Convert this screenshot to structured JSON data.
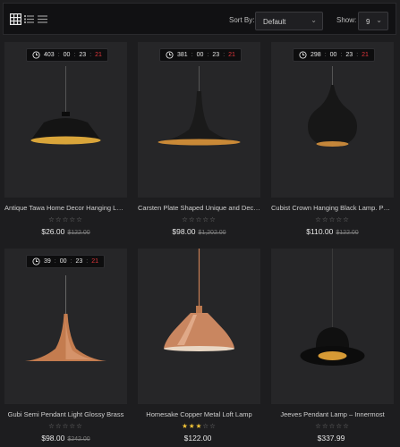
{
  "toolbar": {
    "view_modes": [
      "grid-view",
      "list-view",
      "compact-list-view"
    ],
    "sort_label": "Sort By:",
    "sort_value": "Default",
    "show_label": "Show:",
    "show_value": "9"
  },
  "products": [
    {
      "title": "Antique Tawa Home Decor Hanging Lamp",
      "price": "$26.00",
      "old_price": "$122.00",
      "rating": 0,
      "timer": {
        "days": "403",
        "hours": "00",
        "minutes": "23",
        "seconds": "21"
      }
    },
    {
      "title": "Carsten Plate Shaped Unique and Decorative Lamp",
      "price": "$98.00",
      "old_price": "$1,202.00",
      "rating": 0,
      "timer": {
        "days": "381",
        "hours": "00",
        "minutes": "23",
        "seconds": "21"
      }
    },
    {
      "title": "Cubist Crown Hanging Black Lamp. Pendant",
      "price": "$110.00",
      "old_price": "$122.00",
      "rating": 0,
      "timer": {
        "days": "298",
        "hours": "00",
        "minutes": "23",
        "seconds": "21"
      }
    },
    {
      "title": "Gubi Semi Pendant Light Glossy Brass",
      "price": "$98.00",
      "old_price": "$242.00",
      "rating": 0,
      "timer": {
        "days": "39",
        "hours": "00",
        "minutes": "23",
        "seconds": "21"
      }
    },
    {
      "title": "Homesake Copper Metal Loft Lamp",
      "price": "$122.00",
      "old_price": "",
      "rating": 3,
      "timer": null
    },
    {
      "title": "Jeeves Pendant Lamp – Innermost",
      "price": "$337.99",
      "old_price": "",
      "rating": 0,
      "timer": null
    }
  ],
  "colors": {
    "star_on": "#f3c437",
    "timer_seconds": "#e0363b",
    "gold": "#d4a03a",
    "copper": "#c87f55"
  }
}
